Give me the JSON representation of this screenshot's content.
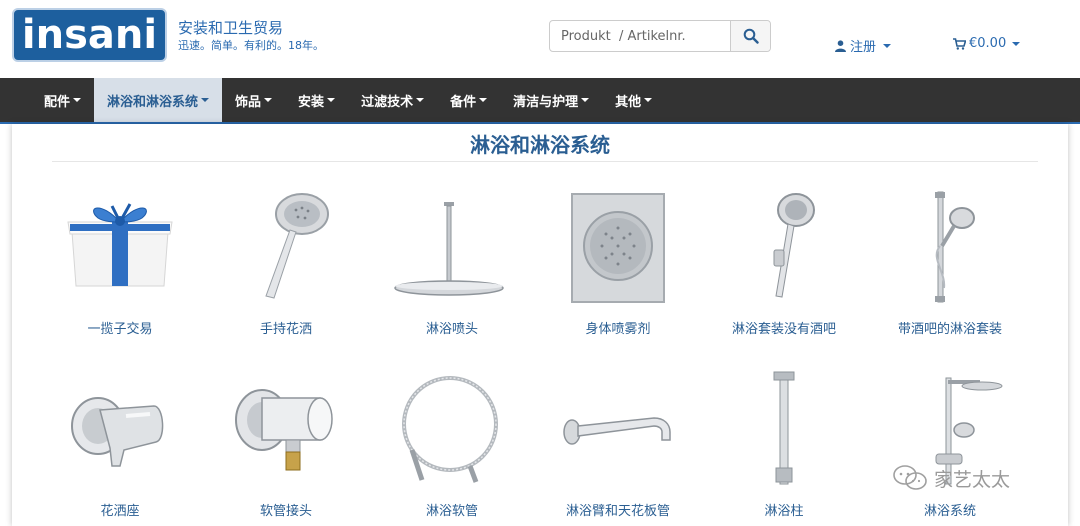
{
  "header": {
    "logo_text": "insani",
    "tagline_line1": "安装和卫生贸易",
    "tagline_line2": "迅速。简单。有利的。18年。"
  },
  "search": {
    "placeholder": "Produkt  / Artikelnr.",
    "button_icon": "search-icon"
  },
  "account": {
    "label": "注册",
    "icon": "user-icon"
  },
  "cart": {
    "label": "€0.00",
    "icon": "cart-icon"
  },
  "nav": {
    "items": [
      {
        "label": "配件"
      },
      {
        "label": "淋浴和淋浴系统",
        "active": true
      },
      {
        "label": "饰品"
      },
      {
        "label": "安装"
      },
      {
        "label": "过滤技术"
      },
      {
        "label": "备件"
      },
      {
        "label": "清洁与护理"
      },
      {
        "label": "其他"
      }
    ]
  },
  "page": {
    "title": "淋浴和淋浴系统"
  },
  "categories": [
    {
      "label": "一揽子交易",
      "image": "gift-box"
    },
    {
      "label": "手持花洒",
      "image": "hand-shower"
    },
    {
      "label": "淋浴喷头",
      "image": "overhead-shower"
    },
    {
      "label": "身体喷雾剂",
      "image": "body-spray"
    },
    {
      "label": "淋浴套装没有酒吧",
      "image": "hand-shower-holder"
    },
    {
      "label": "带酒吧的淋浴套装",
      "image": "shower-bar-set"
    },
    {
      "label": "花洒座",
      "image": "shower-holder"
    },
    {
      "label": "软管接头",
      "image": "hose-connector"
    },
    {
      "label": "淋浴软管",
      "image": "shower-hose"
    },
    {
      "label": "淋浴臂和天花板管",
      "image": "shower-arm"
    },
    {
      "label": "淋浴柱",
      "image": "shower-column"
    },
    {
      "label": "淋浴系统",
      "image": "shower-system"
    }
  ],
  "watermark": {
    "text": "家艺太太"
  },
  "colors": {
    "brand": "#1d5f9e",
    "link": "#2a5e92",
    "navbar": "#333333",
    "nav_active": "#d7dfe8"
  }
}
